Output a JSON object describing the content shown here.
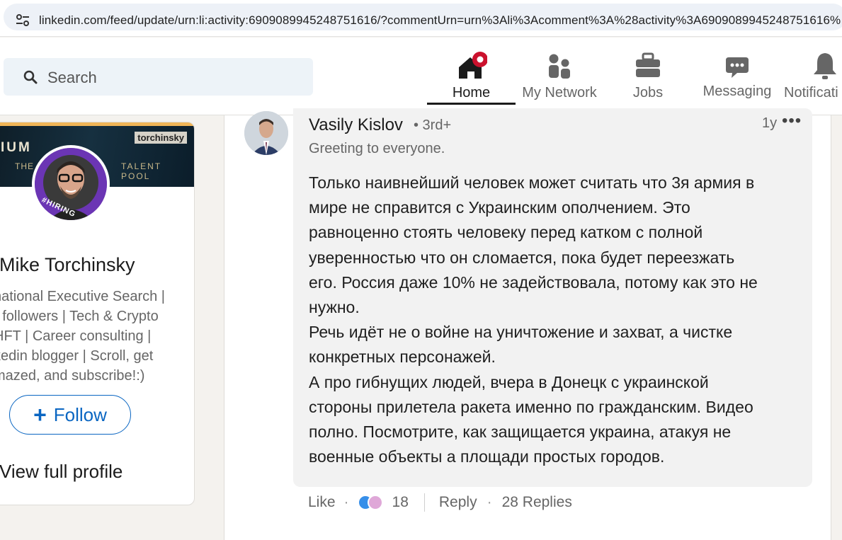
{
  "browser": {
    "url": "linkedin.com/feed/update/urn:li:activity:6909089945248751616/?commentUrn=urn%3Ali%3Acomment%3A%28activity%3A6909089945248751616%"
  },
  "header": {
    "search_placeholder": "Search",
    "nav": [
      {
        "label": "Home",
        "icon": "home-icon",
        "active": true
      },
      {
        "label": "My Network",
        "icon": "network-icon"
      },
      {
        "label": "Jobs",
        "icon": "briefcase-icon"
      },
      {
        "label": "Messaging",
        "icon": "messaging-icon"
      },
      {
        "label": "Notificati",
        "icon": "bell-icon"
      }
    ],
    "accent": "#0a66c2",
    "badge_color": "#cb112d"
  },
  "profile_card": {
    "banner_text_1": "IUM",
    "banner_text_2": "THE",
    "banner_text_3": "TALENT POOL",
    "banner_tag": "torchinsky",
    "hiring_badge": "#HIRING",
    "name": "Mike Torchinsky",
    "headline_lines": [
      "national Executive Search |",
      "- followers | Tech & Crypto",
      "HFT | Career consulting |",
      "kedin blogger | Scroll, get",
      "mazed, and subscribe!:)"
    ],
    "follow_label": "Follow",
    "view_profile_label": "View full profile"
  },
  "comment": {
    "author": "Vasily Kislov",
    "degree": "• 3rd+",
    "tagline": "Greeting to everyone.",
    "time": "1y",
    "more": "•••",
    "body": "Только наивнейший человек может считать что 3я армия в\nмире не справится с Украинским ополчением. Это\nравноценно стоять человеку перед катком с полной\nуверенностью что он сломается, пока будет переезжать\nего. Россия даже 10% не задействовала, потому как это не\nнужно.\nРечь идёт не о войне на уничтожение и захват, а чистке\nконкретных персонажей.\nА про гибнущих людей, вчера в Донецк с украинской\nстороны прилетела ракета именно по гражданским. Видео\nполно. Посмотрите, как защищается украина, атакуя не\nвоенные объекты а площади простых городов.",
    "actions": {
      "like": "Like",
      "reaction_count": "18",
      "reply": "Reply",
      "replies": "28 Replies"
    }
  }
}
